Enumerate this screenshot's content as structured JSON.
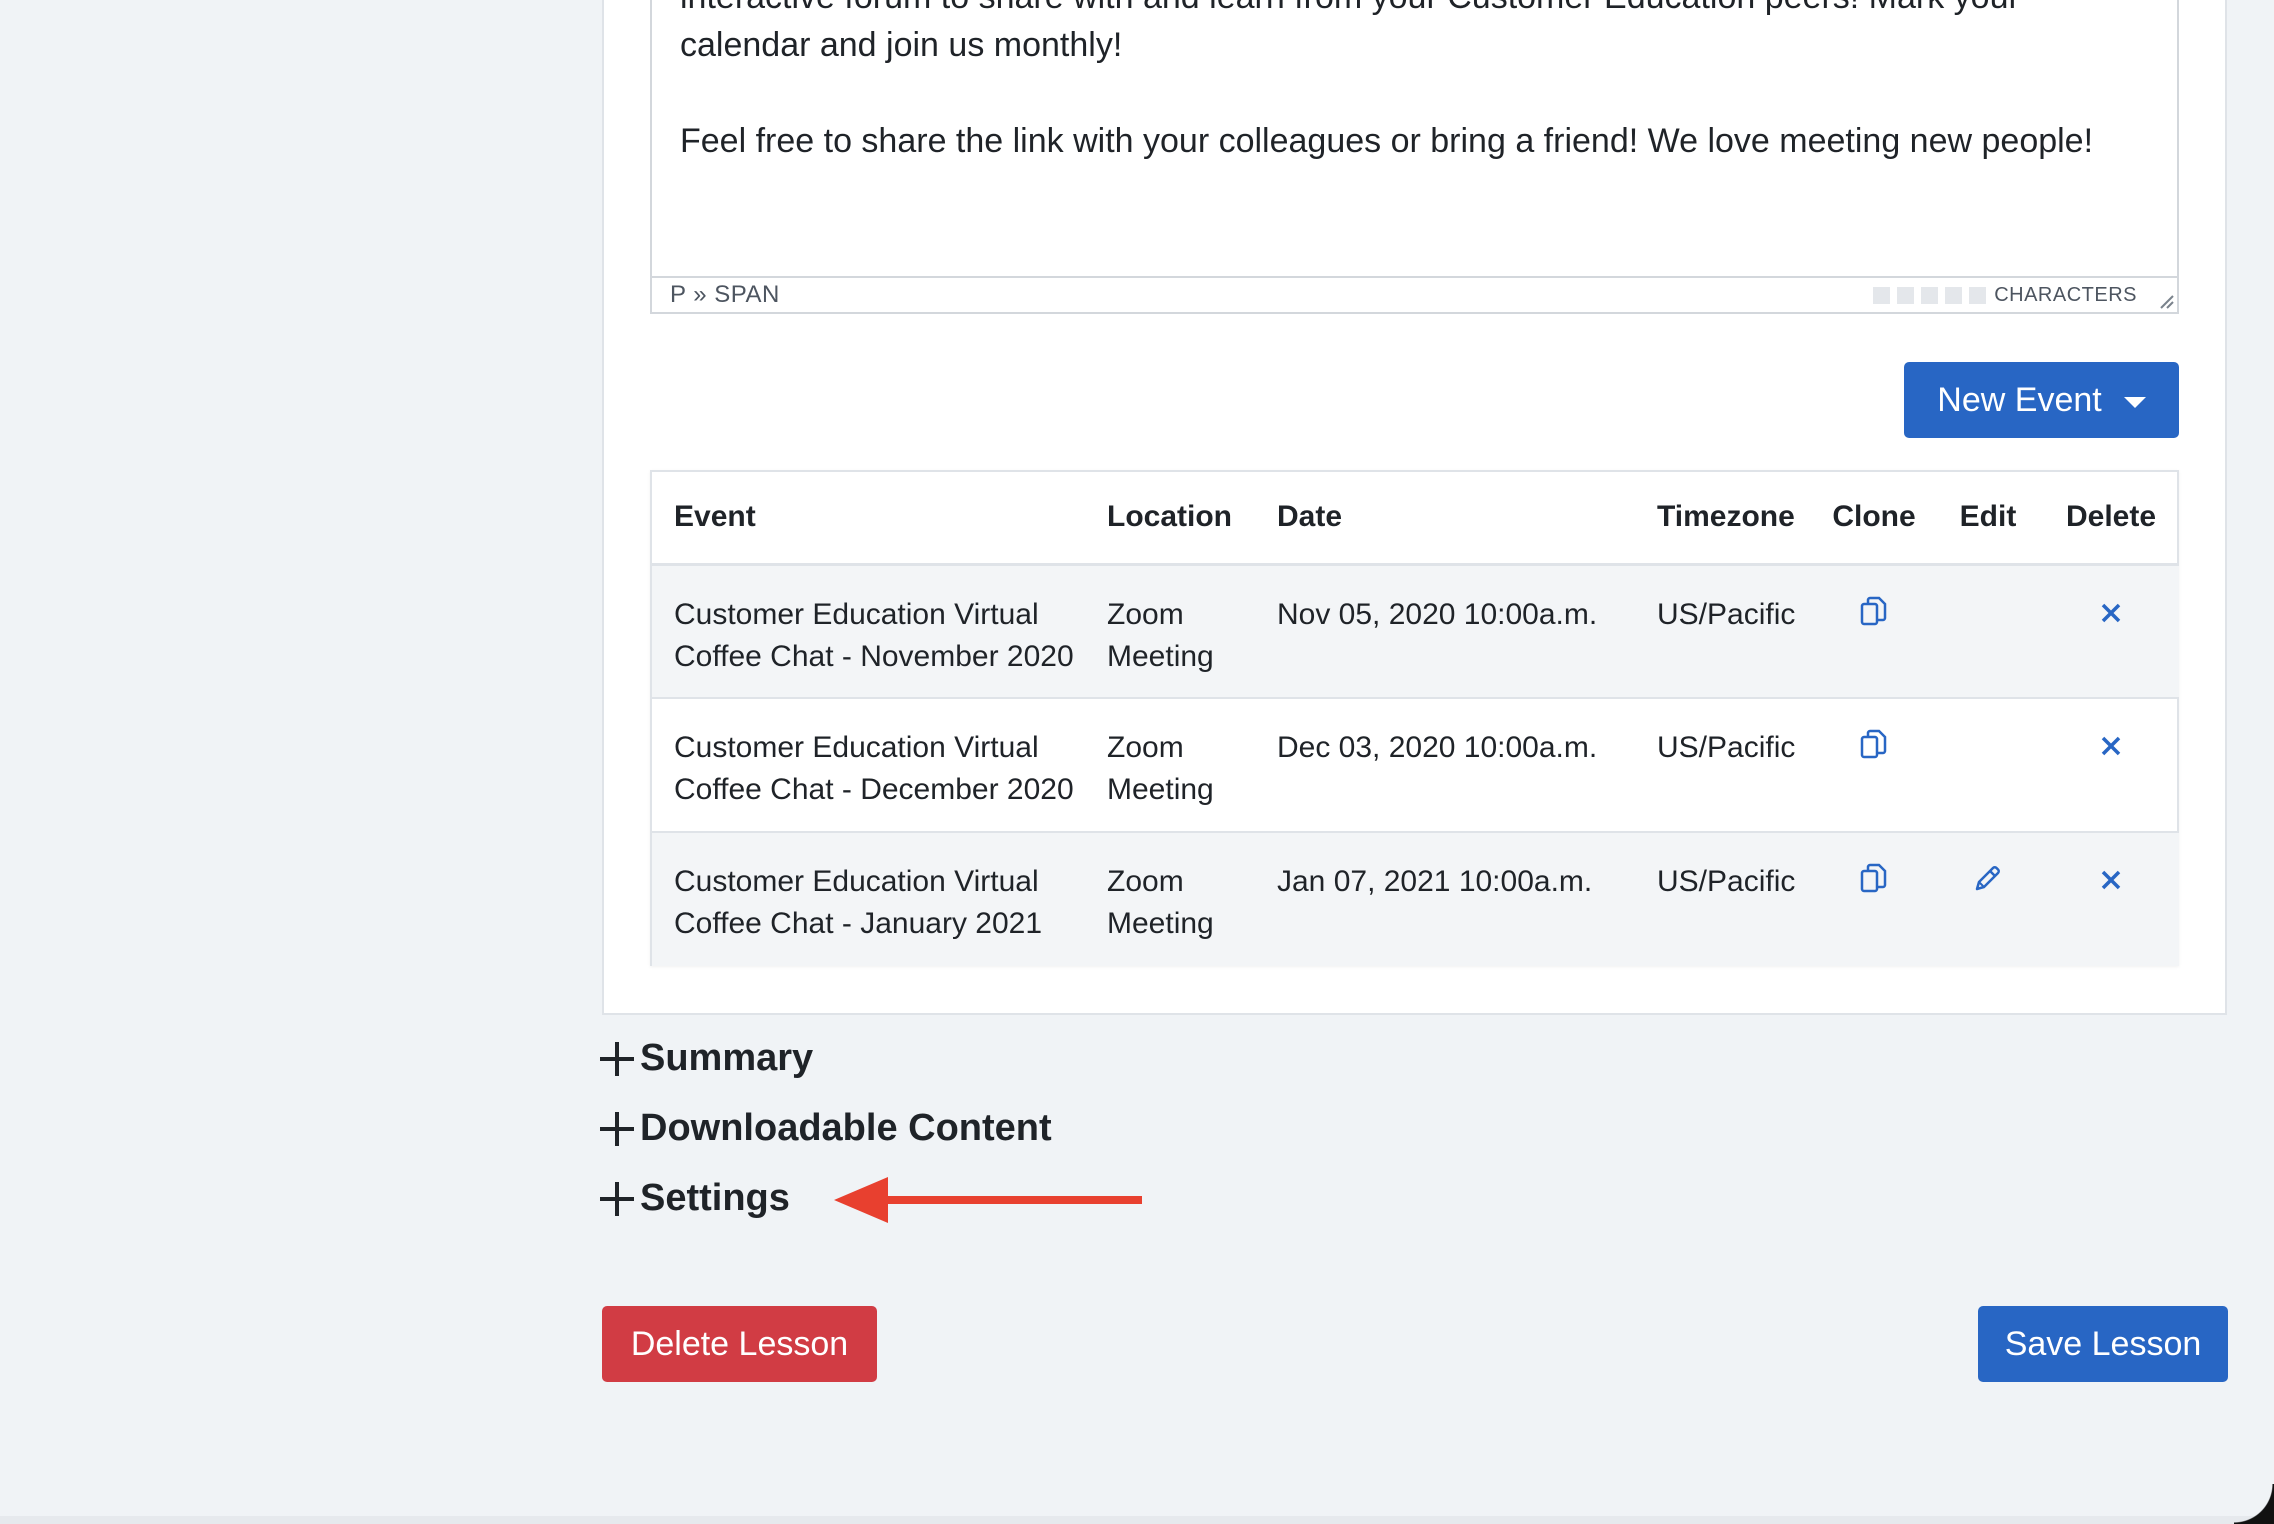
{
  "editor": {
    "paragraph_1_line_1": "interactive forum to share with and learn from your Customer Education peers! Mark your",
    "paragraph_1_line_2": "calendar and join us monthly!",
    "paragraph_2": "Feel free to share the link with your colleagues or bring a friend! We love meeting new people!",
    "status_path": "P » SPAN",
    "characters_label": "CHARACTERS"
  },
  "new_event_button": {
    "label": "New Event"
  },
  "events_table": {
    "headers": [
      "Event",
      "Location",
      "Date",
      "Timezone",
      "Clone",
      "Edit",
      "Delete"
    ],
    "rows": [
      {
        "event_line1": "Customer Education Virtual",
        "event_line2": "Coffee Chat - November 2020",
        "location_line1": "Zoom",
        "location_line2": "Meeting",
        "date": "Nov 05, 2020 10:00a.m.",
        "timezone": "US/Pacific",
        "editable": false
      },
      {
        "event_line1": "Customer Education Virtual",
        "event_line2": "Coffee Chat - December 2020",
        "location_line1": "Zoom",
        "location_line2": "Meeting",
        "date": "Dec 03, 2020 10:00a.m.",
        "timezone": "US/Pacific",
        "editable": false
      },
      {
        "event_line1": "Customer Education Virtual",
        "event_line2": "Coffee Chat - January 2021",
        "location_line1": "Zoom",
        "location_line2": "Meeting",
        "date": "Jan 07, 2021 10:00a.m.",
        "timezone": "US/Pacific",
        "editable": true
      }
    ]
  },
  "sections": {
    "summary": "Summary",
    "downloadable_content": "Downloadable Content",
    "settings": "Settings"
  },
  "actions": {
    "delete_lesson": "Delete Lesson",
    "save_lesson": "Save Lesson"
  },
  "colors": {
    "primary": "#2866c4",
    "danger": "#d13c44",
    "annotation_arrow": "#e8402f",
    "icon_blue": "#2866c4"
  },
  "icons": {
    "clone": "copy-icon",
    "edit": "pencil-icon",
    "delete": "close-icon",
    "section_toggle": "plus-icon",
    "dropdown": "caret-down-icon"
  }
}
